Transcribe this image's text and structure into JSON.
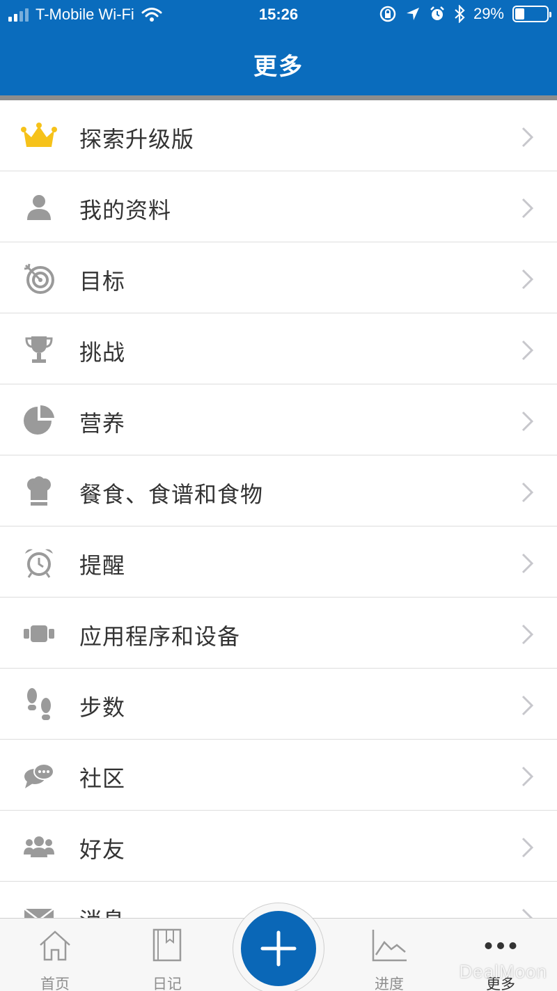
{
  "status_bar": {
    "carrier": "T-Mobile Wi-Fi",
    "time": "15:26",
    "battery": "29%",
    "battery_level": 0.29
  },
  "header": {
    "title": "更多"
  },
  "menu": {
    "items": [
      {
        "label": "探索升级版",
        "icon": "crown-icon"
      },
      {
        "label": "我的资料",
        "icon": "person-icon"
      },
      {
        "label": "目标",
        "icon": "target-icon"
      },
      {
        "label": "挑战",
        "icon": "trophy-icon"
      },
      {
        "label": "营养",
        "icon": "pie-chart-icon"
      },
      {
        "label": "餐食、食谱和食物",
        "icon": "chef-hat-icon"
      },
      {
        "label": "提醒",
        "icon": "alarm-clock-icon"
      },
      {
        "label": "应用程序和设备",
        "icon": "wearable-icon"
      },
      {
        "label": "步数",
        "icon": "footprints-icon"
      },
      {
        "label": "社区",
        "icon": "chat-bubbles-icon"
      },
      {
        "label": "好友",
        "icon": "friends-icon"
      },
      {
        "label": "消息",
        "icon": "envelope-icon"
      }
    ]
  },
  "tabbar": {
    "home": "首页",
    "diary": "日记",
    "progress": "进度",
    "more": "更多"
  },
  "watermark": "DealMoon",
  "colors": {
    "header_bg": "#0a6cbd",
    "fab": "#0a67b7",
    "crown": "#f6c21a",
    "icon_gray": "#9a9a9a"
  }
}
